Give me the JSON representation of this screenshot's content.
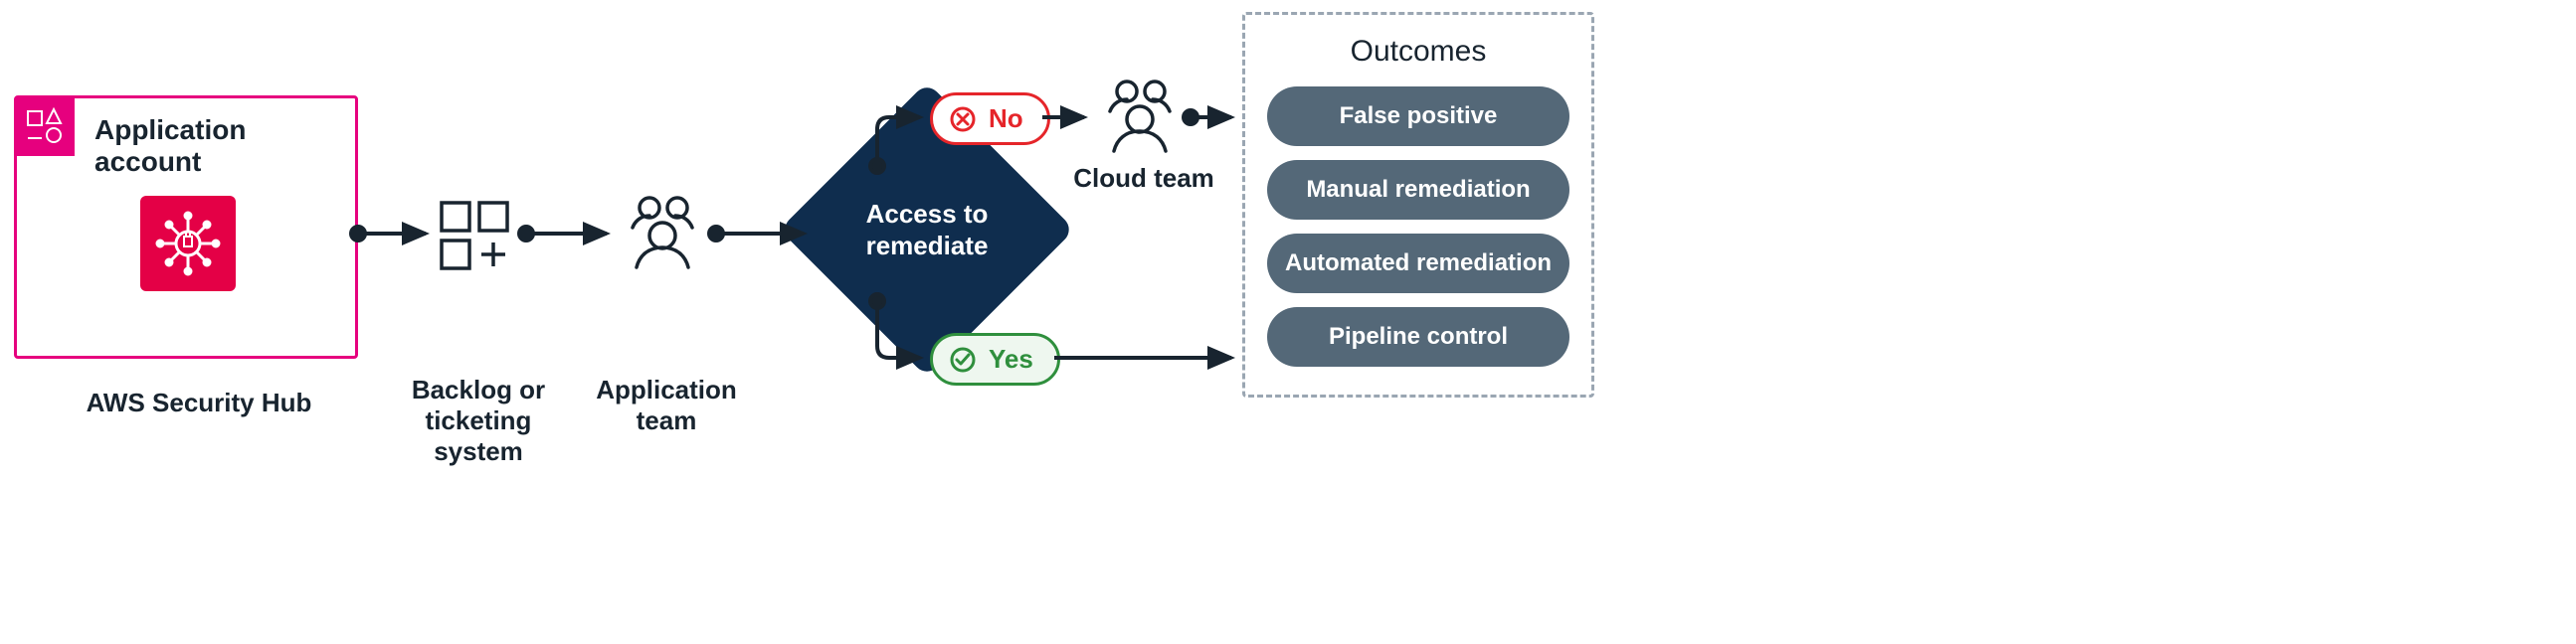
{
  "account": {
    "title": "Application account",
    "hub_label": "AWS Security Hub"
  },
  "nodes": {
    "backlog_label": "Backlog or\nticketing system",
    "app_team_label": "Application\nteam",
    "decision_label": "Access to\nremediate",
    "no_label": "No",
    "yes_label": "Yes",
    "cloud_team_label": "Cloud team"
  },
  "outcomes": {
    "title": "Outcomes",
    "items": [
      "False positive",
      "Manual remediation",
      "Automated remediation",
      "Pipeline control"
    ]
  }
}
